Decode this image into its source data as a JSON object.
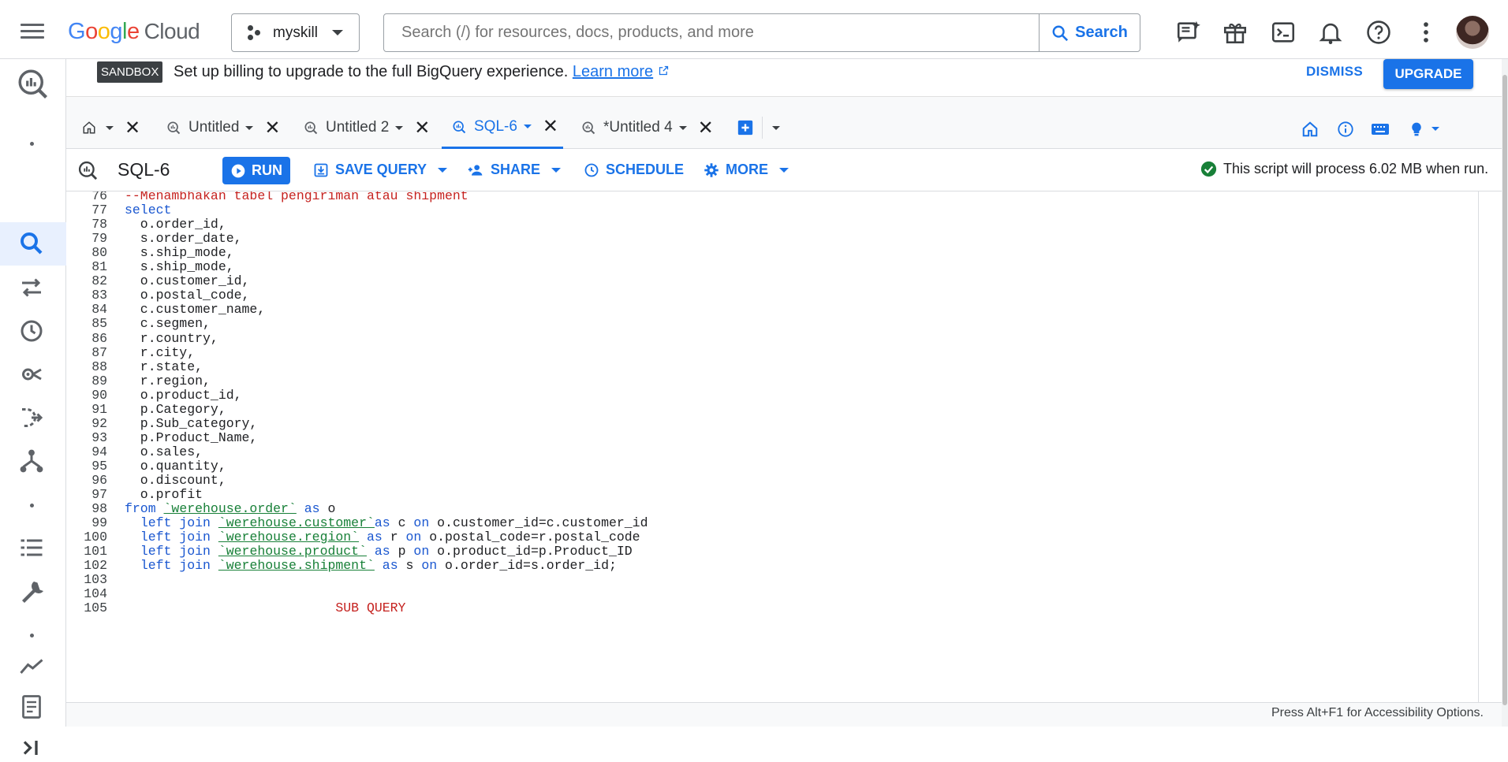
{
  "header": {
    "logo_google": "Google",
    "logo_cloud": "Cloud",
    "project_name": "myskill",
    "search_placeholder": "Search (/) for resources, docs, products, and more",
    "search_button": "Search"
  },
  "banner": {
    "badge": "SANDBOX",
    "message": "Set up billing to upgrade to the full BigQuery experience.",
    "learn_more": "Learn more",
    "dismiss": "DISMISS",
    "upgrade": "UPGRADE"
  },
  "tabs": [
    {
      "label": "Untitled"
    },
    {
      "label": "Untitled 2"
    },
    {
      "label": "SQL-6"
    },
    {
      "label": "*Untitled 4"
    }
  ],
  "query": {
    "title": "SQL-6",
    "run": "RUN",
    "save": "SAVE QUERY",
    "share": "SHARE",
    "schedule": "SCHEDULE",
    "more": "MORE",
    "status": "This script will process 6.02 MB when run."
  },
  "editor": {
    "lines": [
      {
        "n": "76",
        "t": "--Menambhakan tabel pengiriman atau shipment"
      },
      {
        "n": "77",
        "t": "select"
      },
      {
        "n": "78",
        "t": "  o.order_id,"
      },
      {
        "n": "79",
        "t": "  s.order_date,"
      },
      {
        "n": "80",
        "t": "  s.ship_mode,"
      },
      {
        "n": "81",
        "t": "  s.ship_mode,"
      },
      {
        "n": "82",
        "t": "  o.customer_id,"
      },
      {
        "n": "83",
        "t": "  o.postal_code,"
      },
      {
        "n": "84",
        "t": "  c.customer_name,"
      },
      {
        "n": "85",
        "t": "  c.segmen,"
      },
      {
        "n": "86",
        "t": "  r.country,"
      },
      {
        "n": "87",
        "t": "  r.city,"
      },
      {
        "n": "88",
        "t": "  r.state,"
      },
      {
        "n": "89",
        "t": "  r.region,"
      },
      {
        "n": "90",
        "t": "  o.product_id,"
      },
      {
        "n": "91",
        "t": "  p.Category,"
      },
      {
        "n": "92",
        "t": "  p.Sub_category,"
      },
      {
        "n": "93",
        "t": "  p.Product_Name,"
      },
      {
        "n": "94",
        "t": "  o.sales,"
      },
      {
        "n": "95",
        "t": "  o.quantity,"
      },
      {
        "n": "96",
        "t": "  o.discount,"
      },
      {
        "n": "97",
        "t": "  o.profit"
      },
      {
        "n": "98",
        "t": "from `werehouse.order` as o"
      },
      {
        "n": "99",
        "t": "  left join `werehouse.customer`as c on o.customer_id=c.customer_id"
      },
      {
        "n": "100",
        "t": "  left join `werehouse.region` as r on o.postal_code=r.postal_code"
      },
      {
        "n": "101",
        "t": "  left join `werehouse.product` as p on o.product_id=p.Product_ID"
      },
      {
        "n": "102",
        "t": "  left join `werehouse.shipment` as s on o.order_id=s.order_id;"
      },
      {
        "n": "103",
        "t": ""
      },
      {
        "n": "104",
        "t": ""
      },
      {
        "n": "105",
        "t": "                           SUB QUERY"
      }
    ]
  },
  "footer": {
    "a11y": "Press Alt+F1 for Accessibility Options."
  },
  "colors": {
    "accent": "#1a73e8",
    "keyword": "#1a57d0",
    "comment": "#c5221f",
    "string": "#188038"
  }
}
